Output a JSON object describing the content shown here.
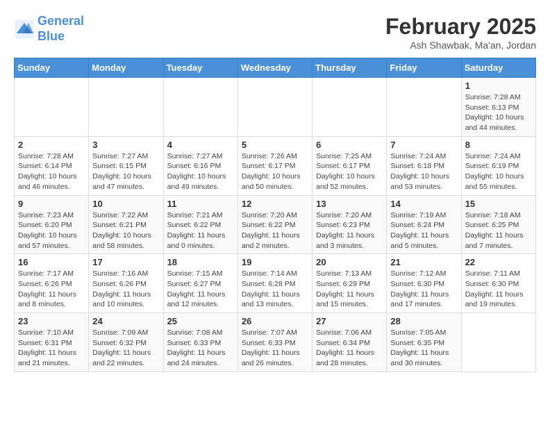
{
  "header": {
    "logo_line1": "General",
    "logo_line2": "Blue",
    "month_title": "February 2025",
    "subtitle": "Ash Shawbak, Ma'an, Jordan"
  },
  "days_of_week": [
    "Sunday",
    "Monday",
    "Tuesday",
    "Wednesday",
    "Thursday",
    "Friday",
    "Saturday"
  ],
  "weeks": [
    [
      {
        "day": "",
        "info": ""
      },
      {
        "day": "",
        "info": ""
      },
      {
        "day": "",
        "info": ""
      },
      {
        "day": "",
        "info": ""
      },
      {
        "day": "",
        "info": ""
      },
      {
        "day": "",
        "info": ""
      },
      {
        "day": "1",
        "info": "Sunrise: 7:28 AM\nSunset: 6:13 PM\nDaylight: 10 hours and 44 minutes."
      }
    ],
    [
      {
        "day": "2",
        "info": "Sunrise: 7:28 AM\nSunset: 6:14 PM\nDaylight: 10 hours and 46 minutes."
      },
      {
        "day": "3",
        "info": "Sunrise: 7:27 AM\nSunset: 6:15 PM\nDaylight: 10 hours and 47 minutes."
      },
      {
        "day": "4",
        "info": "Sunrise: 7:27 AM\nSunset: 6:16 PM\nDaylight: 10 hours and 49 minutes."
      },
      {
        "day": "5",
        "info": "Sunrise: 7:26 AM\nSunset: 6:17 PM\nDaylight: 10 hours and 50 minutes."
      },
      {
        "day": "6",
        "info": "Sunrise: 7:25 AM\nSunset: 6:17 PM\nDaylight: 10 hours and 52 minutes."
      },
      {
        "day": "7",
        "info": "Sunrise: 7:24 AM\nSunset: 6:18 PM\nDaylight: 10 hours and 53 minutes."
      },
      {
        "day": "8",
        "info": "Sunrise: 7:24 AM\nSunset: 6:19 PM\nDaylight: 10 hours and 55 minutes."
      }
    ],
    [
      {
        "day": "9",
        "info": "Sunrise: 7:23 AM\nSunset: 6:20 PM\nDaylight: 10 hours and 57 minutes."
      },
      {
        "day": "10",
        "info": "Sunrise: 7:22 AM\nSunset: 6:21 PM\nDaylight: 10 hours and 58 minutes."
      },
      {
        "day": "11",
        "info": "Sunrise: 7:21 AM\nSunset: 6:22 PM\nDaylight: 11 hours and 0 minutes."
      },
      {
        "day": "12",
        "info": "Sunrise: 7:20 AM\nSunset: 6:22 PM\nDaylight: 11 hours and 2 minutes."
      },
      {
        "day": "13",
        "info": "Sunrise: 7:20 AM\nSunset: 6:23 PM\nDaylight: 11 hours and 3 minutes."
      },
      {
        "day": "14",
        "info": "Sunrise: 7:19 AM\nSunset: 6:24 PM\nDaylight: 11 hours and 5 minutes."
      },
      {
        "day": "15",
        "info": "Sunrise: 7:18 AM\nSunset: 6:25 PM\nDaylight: 11 hours and 7 minutes."
      }
    ],
    [
      {
        "day": "16",
        "info": "Sunrise: 7:17 AM\nSunset: 6:26 PM\nDaylight: 11 hours and 8 minutes."
      },
      {
        "day": "17",
        "info": "Sunrise: 7:16 AM\nSunset: 6:26 PM\nDaylight: 11 hours and 10 minutes."
      },
      {
        "day": "18",
        "info": "Sunrise: 7:15 AM\nSunset: 6:27 PM\nDaylight: 11 hours and 12 minutes."
      },
      {
        "day": "19",
        "info": "Sunrise: 7:14 AM\nSunset: 6:28 PM\nDaylight: 11 hours and 13 minutes."
      },
      {
        "day": "20",
        "info": "Sunrise: 7:13 AM\nSunset: 6:29 PM\nDaylight: 11 hours and 15 minutes."
      },
      {
        "day": "21",
        "info": "Sunrise: 7:12 AM\nSunset: 6:30 PM\nDaylight: 11 hours and 17 minutes."
      },
      {
        "day": "22",
        "info": "Sunrise: 7:11 AM\nSunset: 6:30 PM\nDaylight: 11 hours and 19 minutes."
      }
    ],
    [
      {
        "day": "23",
        "info": "Sunrise: 7:10 AM\nSunset: 6:31 PM\nDaylight: 11 hours and 21 minutes."
      },
      {
        "day": "24",
        "info": "Sunrise: 7:09 AM\nSunset: 6:32 PM\nDaylight: 11 hours and 22 minutes."
      },
      {
        "day": "25",
        "info": "Sunrise: 7:08 AM\nSunset: 6:33 PM\nDaylight: 11 hours and 24 minutes."
      },
      {
        "day": "26",
        "info": "Sunrise: 7:07 AM\nSunset: 6:33 PM\nDaylight: 11 hours and 26 minutes."
      },
      {
        "day": "27",
        "info": "Sunrise: 7:06 AM\nSunset: 6:34 PM\nDaylight: 11 hours and 28 minutes."
      },
      {
        "day": "28",
        "info": "Sunrise: 7:05 AM\nSunset: 6:35 PM\nDaylight: 11 hours and 30 minutes."
      },
      {
        "day": "",
        "info": ""
      }
    ]
  ]
}
